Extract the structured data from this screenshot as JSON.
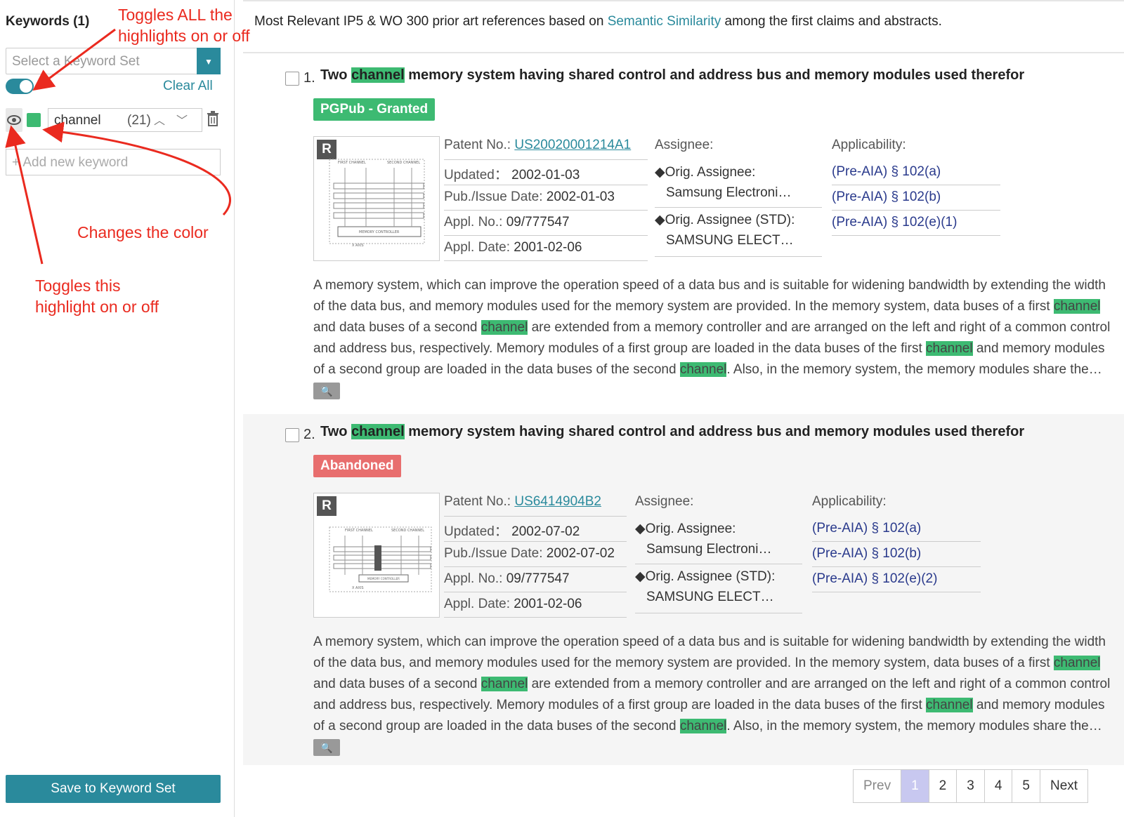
{
  "sidebar": {
    "title": "Keywords (1)",
    "select_placeholder": "Select a Keyword Set",
    "clear_all": "Clear All",
    "keyword": {
      "name": "channel",
      "count": "(21)",
      "color": "#3dba72"
    },
    "add_placeholder": "+ Add new keyword",
    "save_label": "Save to Keyword Set"
  },
  "annotations": {
    "toggle_all": "Toggles ALL the\nhighlights on or off",
    "change_color": "Changes the color",
    "toggle_this": "Toggles this\nhighlight on or off"
  },
  "header": {
    "prefix": "Most Relevant IP5 & WO 300 prior art references based on ",
    "link": "Semantic Similarity",
    "suffix": " among the first claims and abstracts."
  },
  "labels": {
    "patent_no": "Patent No.:",
    "updated": "Updated：",
    "pub_date": "Pub./Issue Date:",
    "appl_no": "Appl. No.:",
    "appl_date": "Appl. Date:",
    "assignee": "Assignee:",
    "orig_assignee": "◆Orig. Assignee:",
    "orig_assignee_std": "◆Orig. Assignee (STD):",
    "applicability": "Applicability:"
  },
  "results": [
    {
      "num": "1.",
      "title_pre": "Two ",
      "title_hl": "channel",
      "title_post": " memory system having shared control and address bus and memory modules used therefor",
      "status": "PGPub - Granted",
      "patent_no": "US20020001214A1",
      "updated": "2002-01-03",
      "pub_date": "2002-01-03",
      "appl_no": "09/777547",
      "appl_date": "2001-02-06",
      "assignee": "Samsung Electroni…",
      "assignee_std": "SAMSUNG ELECT…",
      "applicability": [
        "(Pre-AIA) § 102(a)",
        "(Pre-AIA) § 102(b)",
        "(Pre-AIA) § 102(e)(1)"
      ]
    },
    {
      "num": "2.",
      "title_pre": "Two ",
      "title_hl": "channel",
      "title_post": " memory system having shared control and address bus and memory modules used therefor",
      "status": "Abandoned",
      "patent_no": "US6414904B2",
      "updated": "2002-07-02",
      "pub_date": "2002-07-02",
      "appl_no": "09/777547",
      "appl_date": "2001-02-06",
      "assignee": "Samsung Electroni…",
      "assignee_std": "SAMSUNG ELECT…",
      "applicability": [
        "(Pre-AIA) § 102(a)",
        "(Pre-AIA) § 102(b)",
        "(Pre-AIA) § 102(e)(2)"
      ]
    }
  ],
  "abstract": {
    "p1": "A memory system, which can improve the operation speed of a data bus and is suitable for widening bandwidth by extending the width of the data bus, and memory modules used for the memory system are provided. In the memory system, data buses of a first ",
    "hl": "channel",
    "p2": " and data buses of a second ",
    "p3": " are extended from a memory controller and are arranged on the left and right of a common control and address bus, respectively. Memory modules of a first group are loaded in the data buses of the first ",
    "p4": " and memory modules of a second group are loaded in the data buses of the second ",
    "p5": ". Also, in the memory system, the memory modules share the…"
  },
  "thumb": {
    "first_channel": "FIRST CHANNEL",
    "second_channel": "SECOND CHANNEL",
    "controller": "MEMORY CONTROLLER",
    "axis": "X AXIS"
  },
  "pager": {
    "prev": "Prev",
    "pages": [
      "1",
      "2",
      "3",
      "4",
      "5"
    ],
    "next": "Next"
  }
}
